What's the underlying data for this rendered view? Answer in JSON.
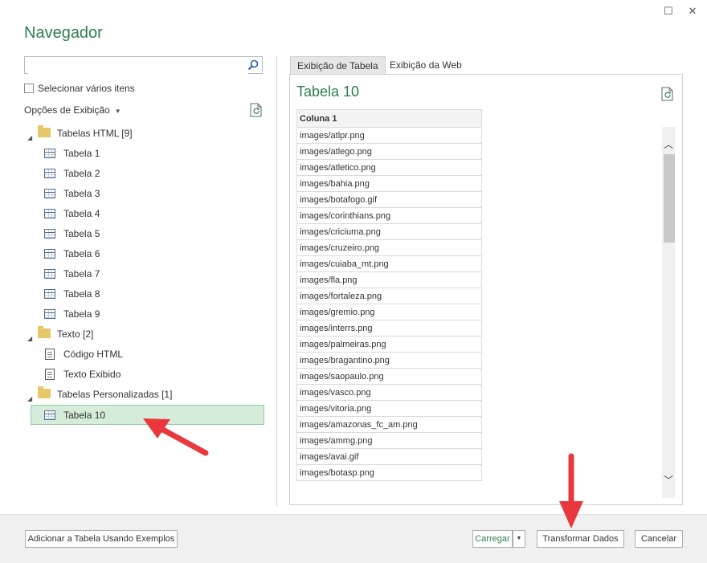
{
  "window": {
    "title": "Navegador",
    "maximize_glyph": "☐",
    "close_glyph": "✕"
  },
  "left": {
    "search": {
      "value": "",
      "placeholder": ""
    },
    "multi_select_label": "Selecionar vários itens",
    "view_options_label": "Opções de Exibição",
    "tree": {
      "html_tables": {
        "label": "Tabelas HTML [9]",
        "items": [
          "Tabela 1",
          "Tabela 2",
          "Tabela 3",
          "Tabela 4",
          "Tabela 5",
          "Tabela 6",
          "Tabela 7",
          "Tabela 8",
          "Tabela 9"
        ]
      },
      "text": {
        "label": "Texto [2]",
        "items": [
          "Código HTML",
          "Texto Exibido"
        ]
      },
      "custom_tables": {
        "label": "Tabelas Personalizadas [1]",
        "items": [
          "Tabela 10"
        ]
      }
    }
  },
  "right": {
    "tabs": [
      "Exibição de Tabela",
      "Exibição da Web"
    ],
    "active_tab": "Exibição de Tabela",
    "preview_title": "Tabela 10",
    "table": {
      "column": "Coluna 1",
      "rows": [
        "images/atlpr.png",
        "images/atlego.png",
        "images/atletico.png",
        "images/bahia.png",
        "images/botafogo.gif",
        "images/corinthians.png",
        "images/criciuma.png",
        "images/cruzeiro.png",
        "images/cuiaba_mt.png",
        "images/fla.png",
        "images/fortaleza.png",
        "images/gremio.png",
        "images/interrs.png",
        "images/palmeiras.png",
        "images/bragantino.png",
        "images/saopaulo.png",
        "images/vasco.png",
        "images/vitoria.png",
        "images/amazonas_fc_am.png",
        "images/ammg.png",
        "images/avai.gif",
        "images/botasp.png"
      ]
    }
  },
  "footer": {
    "add_table_label": "Adicionar a Tabela Usando Exemplos",
    "load_label": "Carregar",
    "transform_label": "Transformar Dados",
    "cancel_label": "Cancelar"
  },
  "colors": {
    "accent_green": "#2e7d4f",
    "selection_bg": "#d4ecd9",
    "annotation_arrow": "#e8383d"
  }
}
